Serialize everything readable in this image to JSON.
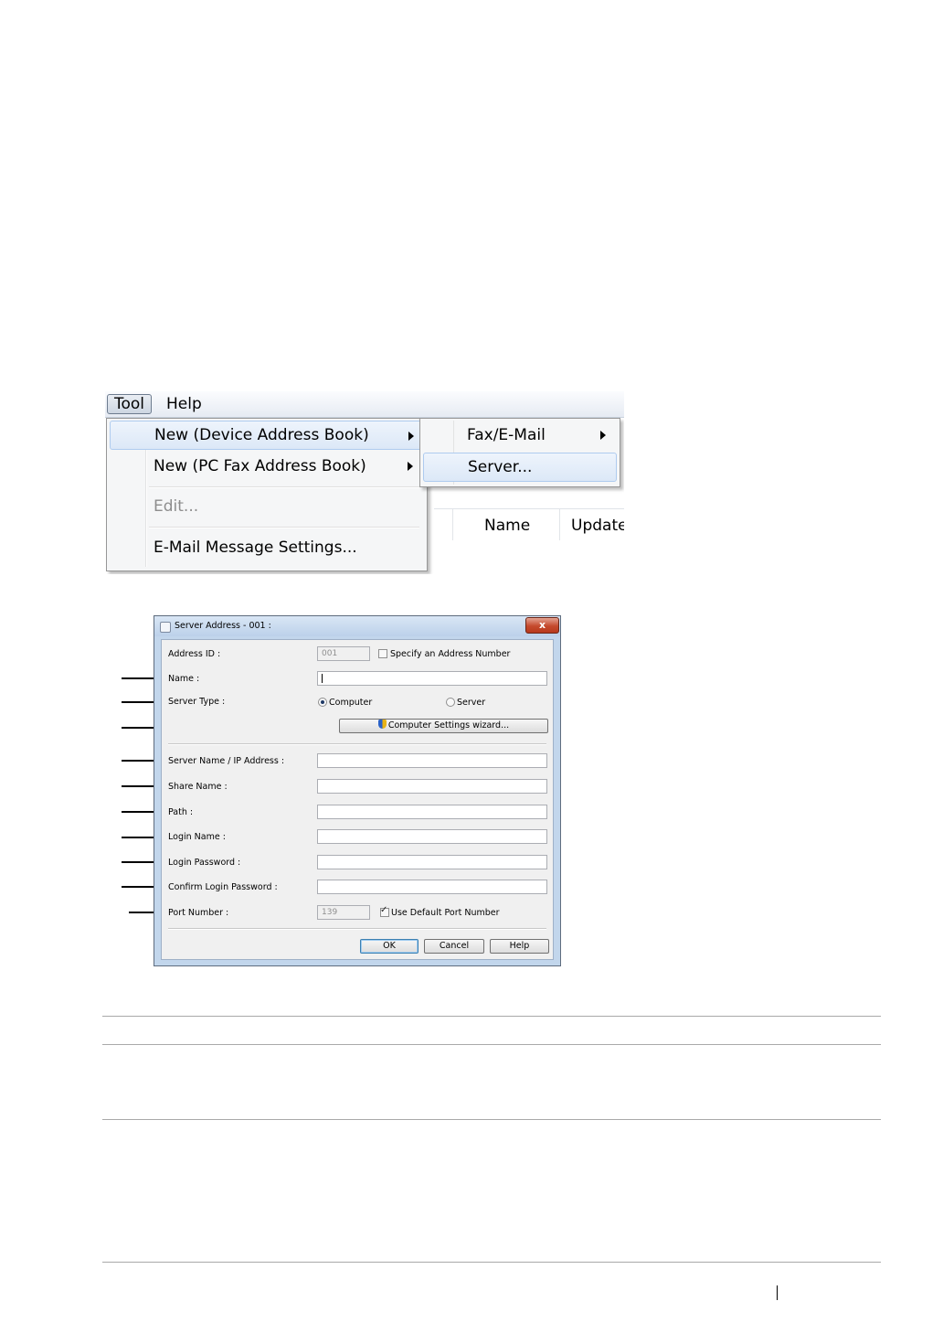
{
  "menu": {
    "menubar": [
      "Tool",
      "Help"
    ],
    "dropdown": {
      "new_device": "New (Device Address Book)",
      "new_pc_fax": "New (PC Fax Address Book)",
      "edit": "Edit...",
      "email_settings": "E-Mail Message Settings..."
    },
    "submenu": {
      "fax_email": "Fax/E-Mail",
      "server": "Server..."
    },
    "background_columns": [
      "Name",
      "Update"
    ]
  },
  "dialog": {
    "title": "Server Address - 001 :",
    "close": "x",
    "address_id_label": "Address ID :",
    "address_id_value": "001",
    "specify_address_number": "Specify an Address Number",
    "name_label": "Name :",
    "server_type_label": "Server Type :",
    "server_type_options": [
      "Computer",
      "Server"
    ],
    "server_type_selected": "Computer",
    "computer_settings_wizard": "Computer Settings wizard...",
    "server_name_label": "Server Name / IP Address :",
    "share_name_label": "Share Name :",
    "path_label": "Path :",
    "login_name_label": "Login Name :",
    "login_password_label": "Login Password :",
    "confirm_login_password_label": "Confirm Login Password :",
    "port_number_label": "Port Number :",
    "port_number_value": "139",
    "use_default_port": "Use Default Port Number",
    "use_default_port_checked": true,
    "buttons": {
      "ok": "OK",
      "cancel": "Cancel",
      "help": "Help"
    }
  }
}
